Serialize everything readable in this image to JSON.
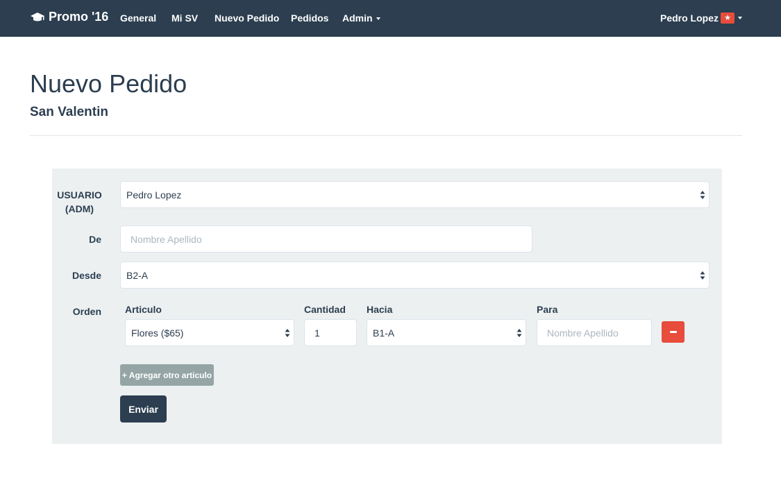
{
  "navbar": {
    "brand": "Promo '16",
    "brand_icon": "graduation-cap-icon",
    "items": [
      {
        "label": "General"
      },
      {
        "label": "Mi SV"
      },
      {
        "label": "Nuevo Pedido"
      },
      {
        "label": "Pedidos"
      },
      {
        "label": "Admin"
      }
    ],
    "user": "Pedro Lopez",
    "user_badge": "★"
  },
  "page": {
    "title": "Nuevo Pedido",
    "subtitle": "San Valentin"
  },
  "form": {
    "usuario_label_line1": "USUARIO",
    "usuario_label_line2": "(ADM)",
    "usuario_value": "Pedro Lopez",
    "de_label": "De",
    "de_placeholder": "Nombre Apellido",
    "desde_label": "Desde",
    "desde_value": "B2-A",
    "orden_label": "Orden",
    "columns": {
      "articulo": "Articulo",
      "cantidad": "Cantidad",
      "hacia": "Hacia",
      "para": "Para"
    },
    "order_row": {
      "articulo": "Flores ($65)",
      "cantidad": "1",
      "hacia": "B1-A",
      "para_placeholder": "Nombre Apellido"
    },
    "add_button": "+ Agregar otro articulo",
    "submit_button": "Enviar"
  },
  "colors": {
    "navbar_bg": "#2c3e50",
    "panel_bg": "#ecf0f1",
    "danger": "#e74c3c",
    "muted_button": "#95a5a6"
  }
}
